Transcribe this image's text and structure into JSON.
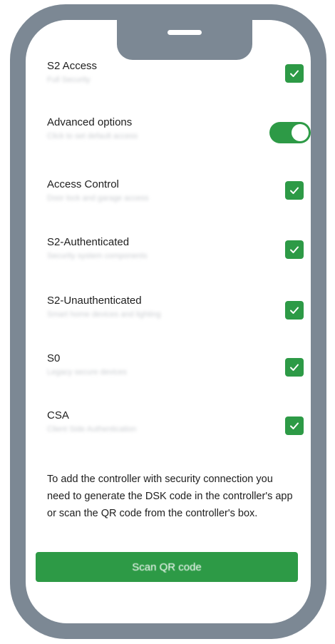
{
  "colors": {
    "accent": "#2d9a46",
    "frame": "#7c8894"
  },
  "options": [
    {
      "title": "S2 Access",
      "subtitle": "Full Security",
      "control": "checkbox",
      "checked": true
    },
    {
      "title": "Advanced options",
      "subtitle": "Click to set default access",
      "control": "toggle",
      "on": true
    },
    {
      "title": "Access Control",
      "subtitle": "Door lock and garage access",
      "control": "checkbox",
      "checked": true
    },
    {
      "title": "S2-Authenticated",
      "subtitle": "Security system components",
      "control": "checkbox",
      "checked": true
    },
    {
      "title": "S2-Unauthenticated",
      "subtitle": "Smart home devices and lighting",
      "control": "checkbox",
      "checked": true
    },
    {
      "title": "S0",
      "subtitle": "Legacy secure devices",
      "control": "checkbox",
      "checked": true
    },
    {
      "title": "CSA",
      "subtitle": "Client Side Authentication",
      "control": "checkbox",
      "checked": true
    }
  ],
  "info_text": "To add the controller with security connection you need to generate the DSK code in the controller's app or scan the QR code from the controller's box.",
  "scan_button_label": "Scan QR code"
}
